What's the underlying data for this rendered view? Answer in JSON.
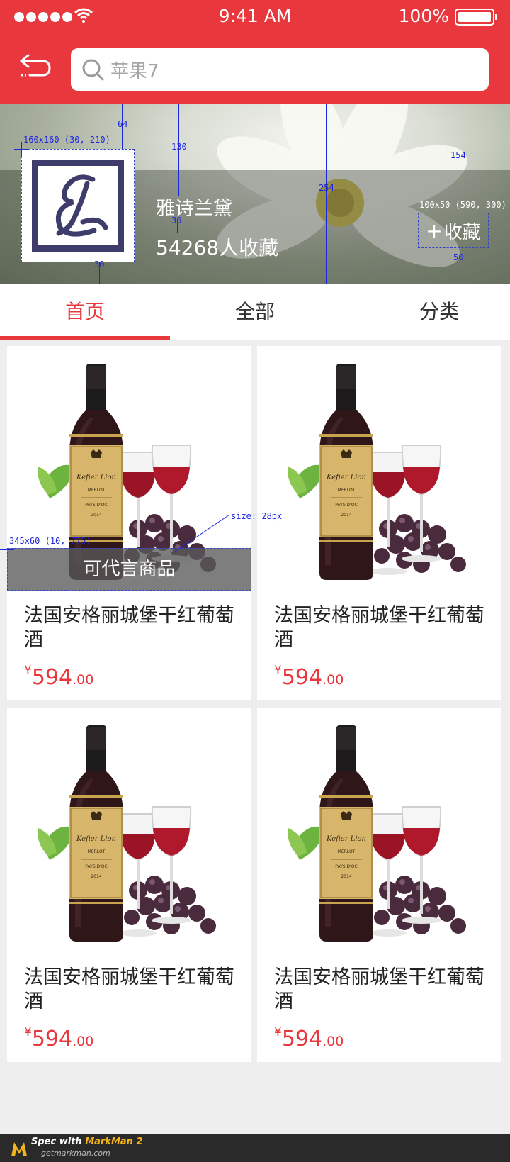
{
  "status_bar": {
    "time": "9:41 AM",
    "battery": "100%"
  },
  "nav": {
    "search_text": "苹果7"
  },
  "shop": {
    "name": "雅诗兰黛",
    "followers": "54268人收藏",
    "favorite_label": "收藏"
  },
  "spec": {
    "logo": "160x160 (30, 210)",
    "fav": "100x50 (590, 300)",
    "proxy": "345x60 (10, 775)",
    "proxy_font": "size: 28px",
    "d64": "64",
    "d130": "130",
    "d254": "254",
    "d154": "154",
    "d30a": "30",
    "d30b": "30",
    "d50": "50"
  },
  "tabs": [
    {
      "label": "首页",
      "active": true
    },
    {
      "label": "全部",
      "active": false
    },
    {
      "label": "分类",
      "active": false
    }
  ],
  "products": [
    {
      "title": "法国安格丽城堡干红葡萄酒",
      "currency": "¥",
      "price_int": "594",
      "price_dec": ".00",
      "overlay": "可代言商品",
      "bottle_label": "Kefier Lion",
      "variety": "MERLOT",
      "region": "PAYS D'OC",
      "year": "2014"
    },
    {
      "title": "法国安格丽城堡干红葡萄酒",
      "currency": "¥",
      "price_int": "594",
      "price_dec": ".00",
      "overlay": "",
      "bottle_label": "Kefier Lion",
      "variety": "MERLOT",
      "region": "PAYS D'OC",
      "year": "2014"
    },
    {
      "title": "法国安格丽城堡干红葡萄酒",
      "currency": "¥",
      "price_int": "594",
      "price_dec": ".00",
      "overlay": "",
      "bottle_label": "Kefier Lion",
      "variety": "MERLOT",
      "region": "PAYS D'OC",
      "year": "2014"
    },
    {
      "title": "法国安格丽城堡干红葡萄酒",
      "currency": "¥",
      "price_int": "594",
      "price_dec": ".00",
      "overlay": "",
      "bottle_label": "Kefier Lion",
      "variety": "MERLOT",
      "region": "PAYS D'OC",
      "year": "2014"
    }
  ],
  "footer": {
    "title_prefix": "Spec with ",
    "title_brand": "MarkMan 2",
    "site": "getmarkman.com"
  },
  "colors": {
    "accent": "#e8383d",
    "logo_navy": "#3e3c6b",
    "wine": "#8e1020"
  }
}
